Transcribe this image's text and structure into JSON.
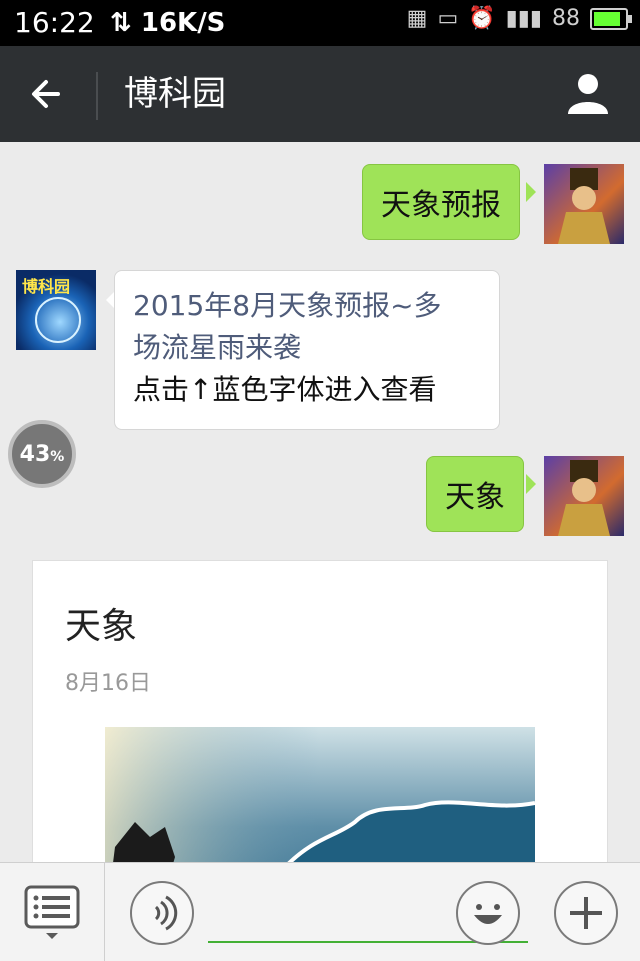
{
  "status_bar": {
    "time": "16:22",
    "net_speed": "16K/S",
    "battery": "88",
    "icons": [
      "grid-icon",
      "message-icon",
      "alarm-icon",
      "signal-icon",
      "battery-icon"
    ]
  },
  "header": {
    "title": "博科园"
  },
  "messages": [
    {
      "direction": "out",
      "text": "天象预报"
    },
    {
      "direction": "in",
      "line1": "2015年8月天象预报~多",
      "line2": "场流星雨来袭",
      "line3": "点击↑蓝色字体进入查看",
      "avatar_text": "博科园"
    },
    {
      "direction": "out",
      "text": "天象"
    }
  ],
  "progress": {
    "value": "43",
    "unit": "%"
  },
  "article_card": {
    "title": "天象",
    "date": "8月16日"
  },
  "colors": {
    "outgoing_bubble": "#9fe358",
    "header_bg": "#2d3033",
    "chat_bg": "#ebebeb",
    "input_underline": "#43b035"
  }
}
